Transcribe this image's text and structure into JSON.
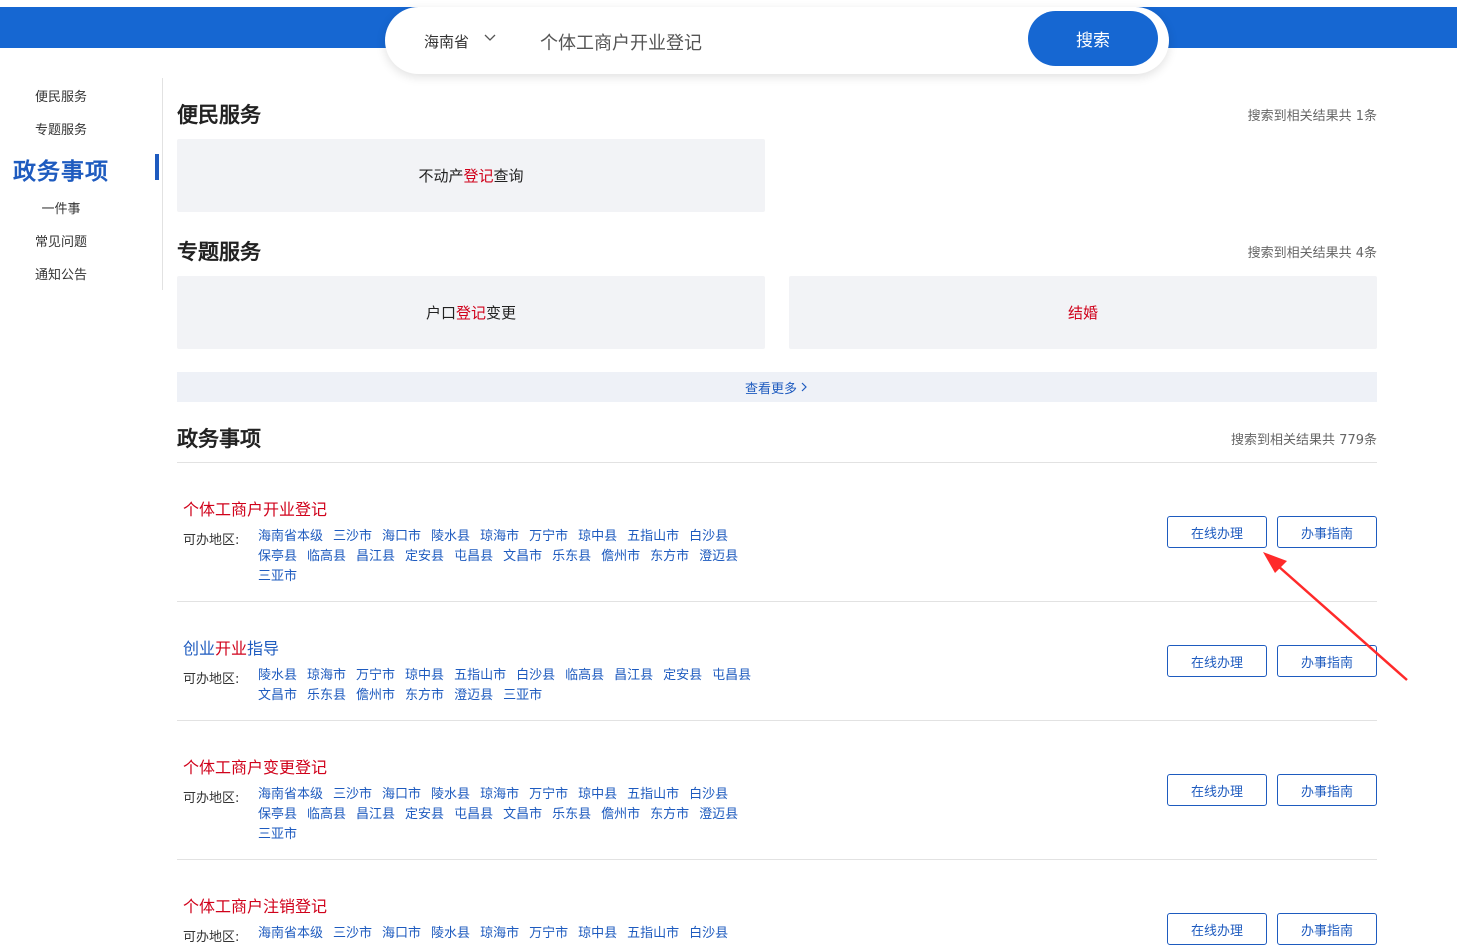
{
  "search": {
    "province": "海南省",
    "query": "个体工商户开业登记",
    "button": "搜索"
  },
  "sidebar": {
    "items": [
      {
        "label": "便民服务"
      },
      {
        "label": "专题服务"
      },
      {
        "label": "政务事项"
      },
      {
        "label": "一件事"
      },
      {
        "label": "常见问题"
      },
      {
        "label": "通知公告"
      }
    ]
  },
  "convenience": {
    "title": "便民服务",
    "count": "搜索到相关结果共 1条",
    "cards": [
      {
        "pre": "不动产",
        "hl": "登记",
        "post": "查询"
      }
    ]
  },
  "topic": {
    "title": "专题服务",
    "count": "搜索到相关结果共 4条",
    "cards": [
      {
        "pre": "户口",
        "hl": "登记",
        "post": "变更"
      },
      {
        "pre": "",
        "hl": "结婚",
        "post": ""
      }
    ],
    "more": "查看更多"
  },
  "affairs": {
    "title": "政务事项",
    "count": "搜索到相关结果共 779条",
    "region_label": "可办地区:",
    "online_label": "在线办理",
    "guide_label": "办事指南",
    "items": [
      {
        "title": "个体工商户开业登记",
        "regions": [
          "海南省本级",
          "三沙市",
          "海口市",
          "陵水县",
          "琼海市",
          "万宁市",
          "琼中县",
          "五指山市",
          "白沙县",
          "保亭县",
          "临高县",
          "昌江县",
          "定安县",
          "屯昌县",
          "文昌市",
          "乐东县",
          "儋州市",
          "东方市",
          "澄迈县",
          "三亚市"
        ]
      },
      {
        "title_pre": "创业",
        "title_hl": "开业",
        "title_post": "指导",
        "regions": [
          "陵水县",
          "琼海市",
          "万宁市",
          "琼中县",
          "五指山市",
          "白沙县",
          "临高县",
          "昌江县",
          "定安县",
          "屯昌县",
          "文昌市",
          "乐东县",
          "儋州市",
          "东方市",
          "澄迈县",
          "三亚市"
        ]
      },
      {
        "title": "个体工商户变更登记",
        "regions": [
          "海南省本级",
          "三沙市",
          "海口市",
          "陵水县",
          "琼海市",
          "万宁市",
          "琼中县",
          "五指山市",
          "白沙县",
          "保亭县",
          "临高县",
          "昌江县",
          "定安县",
          "屯昌县",
          "文昌市",
          "乐东县",
          "儋州市",
          "东方市",
          "澄迈县",
          "三亚市"
        ]
      },
      {
        "title": "个体工商户注销登记",
        "regions": [
          "海南省本级",
          "三沙市",
          "海口市",
          "陵水县",
          "琼海市",
          "万宁市",
          "琼中县",
          "五指山市",
          "白沙县"
        ]
      }
    ]
  },
  "colors": {
    "brand": "#1667d2",
    "link": "#1e5bbf",
    "highlight": "#d0021b",
    "annotation_arrow": "#ff2a2a"
  }
}
